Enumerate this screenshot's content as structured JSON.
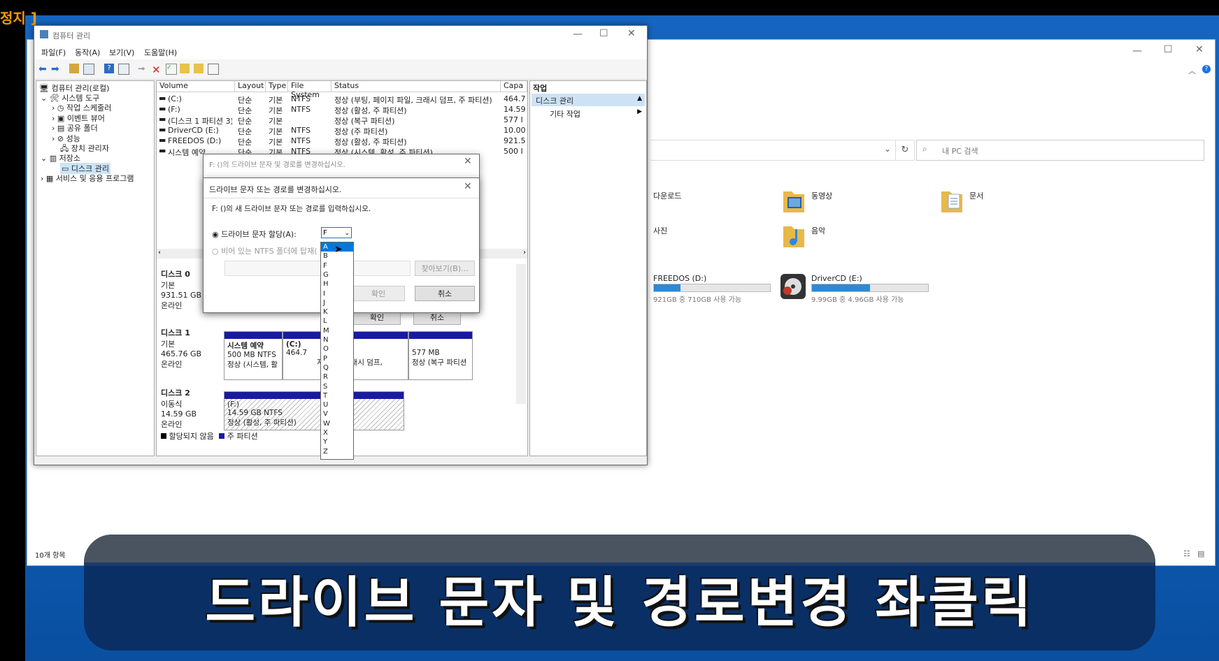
{
  "corner_label": "정지 ]",
  "explorer": {
    "search_placeholder": "내 PC 검색",
    "folders": [
      {
        "label": "다운로드"
      },
      {
        "label": "동영상"
      },
      {
        "label": "문서"
      },
      {
        "label": "사진"
      },
      {
        "label": "음악"
      }
    ],
    "drives": [
      {
        "label": "FREEDOS (D:)",
        "status": "921GB 중 710GB 사용 가능",
        "used_fraction": 0.23
      },
      {
        "label": "DriverCD (E:)",
        "status": "9.99GB 중 4.96GB 사용 가능",
        "used_fraction": 0.5
      }
    ],
    "item_count": "10개 항목"
  },
  "cm": {
    "title": "컴퓨터 관리",
    "menu": [
      "파일(F)",
      "동작(A)",
      "보기(V)",
      "도움말(H)"
    ],
    "tree": {
      "root": "컴퓨터 관리(로컬)",
      "system_tools": "시스템 도구",
      "task_scheduler": "작업 스케줄러",
      "event_viewer": "이벤트 뷰어",
      "shared_folders": "공유 폴더",
      "performance": "성능",
      "device_manager": "장치 관리자",
      "storage": "저장소",
      "disk_mgmt": "디스크 관리",
      "services": "서비스 및 응용 프로그램"
    },
    "columns": [
      "Volume",
      "Layout",
      "Type",
      "File System",
      "Status",
      "Capa"
    ],
    "rows": [
      [
        "(C:)",
        "단순",
        "기본",
        "NTFS",
        "정상 (부팅, 페이지 파일, 크래시 덤프, 주 파티션)",
        "464.7"
      ],
      [
        "(F:)",
        "단순",
        "기본",
        "NTFS",
        "정상 (활성, 주 파티션)",
        "14.59"
      ],
      [
        "(디스크 1 파티션 3)",
        "단순",
        "기본",
        "",
        "정상 (복구 파티션)",
        "577 I"
      ],
      [
        "DriverCD (E:)",
        "단순",
        "기본",
        "NTFS",
        "정상 (주 파티션)",
        "10.00"
      ],
      [
        "FREEDOS (D:)",
        "단순",
        "기본",
        "NTFS",
        "정상 (활성, 주 파티션)",
        "921.5"
      ],
      [
        "시스템 예약",
        "단순",
        "기본",
        "NTFS",
        "정상 (시스템, 활성, 주 파티션)",
        "500 I"
      ]
    ],
    "disks": {
      "d0": {
        "name": "디스크 0",
        "type": "기본",
        "size": "931.51 GB",
        "state": "온라인"
      },
      "d1": {
        "name": "디스크 1",
        "type": "기본",
        "size": "465.76 GB",
        "state": "온라인",
        "p1_name": "시스템 예약",
        "p1_size": "500 MB NTFS",
        "p1_status": "정상 (시스템, 활",
        "p2_name": "(C:)",
        "p2_size": "464.7",
        "p3_status": "지 파일, 크래시 덤프,",
        "p4_size": "577 MB",
        "p4_status": "정상 (복구 파티션"
      },
      "d2": {
        "name": "디스크 2",
        "type": "이동식",
        "size": "14.59 GB",
        "state": "온라인",
        "p1_name": "(F:)",
        "p1_size": "14.59 GB NTFS",
        "p1_status": "정상 (활성, 주 파티션)"
      }
    },
    "legend": [
      "할당되지 않음",
      "주 파티션"
    ],
    "actions": {
      "header": "작업",
      "disk_mgmt": "디스크 관리",
      "more": "기타 작업"
    }
  },
  "dlg_back": {
    "title": "F: ()의 드라이브 문자 및 경로를 변경하십시오.",
    "ok": "확인",
    "cancel": "취소"
  },
  "dlg_front": {
    "title": "드라이브 문자 또는 경로를 변경하십시오.",
    "prompt": "F: ()의 새 드라이브 문자 또는 경로를 입력하십시오.",
    "radio_assign": "드라이브 문자 할당(A):",
    "radio_mount": "비어 있는 NTFS 폴더에 탑재(",
    "selected_letter": "F",
    "browse": "찾아보기(B)...",
    "ok": "확인",
    "cancel": "취소"
  },
  "letters": [
    "A",
    "B",
    "F",
    "G",
    "H",
    "I",
    "J",
    "K",
    "L",
    "M",
    "N",
    "O",
    "P",
    "Q",
    "R",
    "S",
    "T",
    "U",
    "V",
    "W",
    "X",
    "Y",
    "Z"
  ],
  "caption": "드라이브 문자 및 경로변경 좌클릭"
}
